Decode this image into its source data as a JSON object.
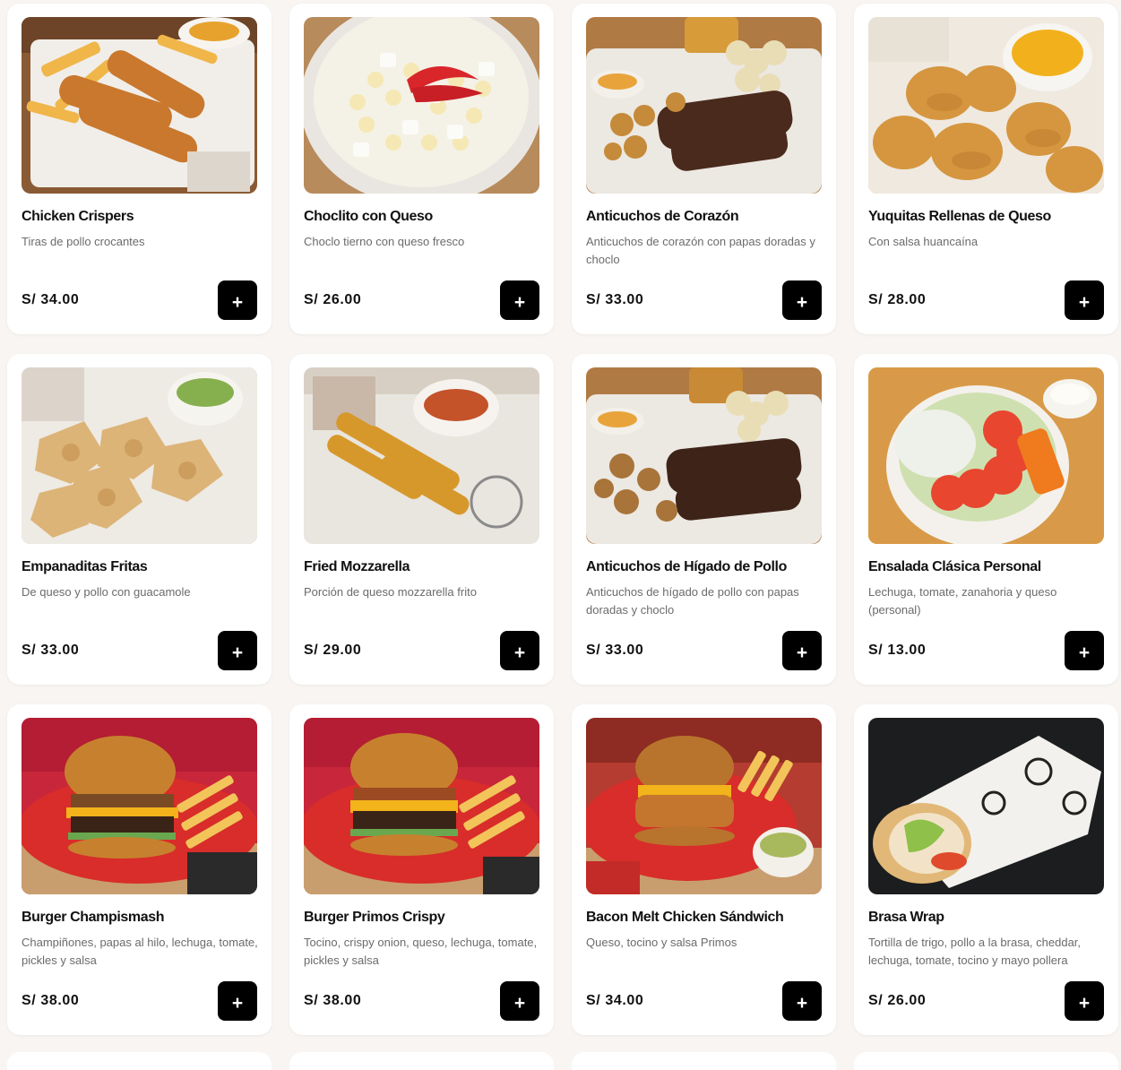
{
  "products": [
    {
      "name": "Chicken Crispers",
      "description": "Tiras de pollo crocantes",
      "price": "S/ 34.00",
      "add_label": "+"
    },
    {
      "name": "Choclito con Queso",
      "description": "Choclo tierno con queso fresco",
      "price": "S/ 26.00",
      "add_label": "+"
    },
    {
      "name": "Anticuchos de Corazón",
      "description": "Anticuchos de corazón con papas doradas y choclo",
      "price": "S/ 33.00",
      "add_label": "+"
    },
    {
      "name": "Yuquitas Rellenas de Queso",
      "description": "Con salsa huancaína",
      "price": "S/ 28.00",
      "add_label": "+"
    },
    {
      "name": "Empanaditas Fritas",
      "description": "De queso y pollo con guacamole",
      "price": "S/ 33.00",
      "add_label": "+"
    },
    {
      "name": "Fried Mozzarella",
      "description": "Porción de queso mozzarella frito",
      "price": "S/ 29.00",
      "add_label": "+"
    },
    {
      "name": "Anticuchos de Hígado de Pollo",
      "description": "Anticuchos de hígado de pollo con papas doradas y choclo",
      "price": "S/ 33.00",
      "add_label": "+"
    },
    {
      "name": "Ensalada Clásica Personal",
      "description": "Lechuga, tomate, zanahoria y queso (personal)",
      "price": "S/ 13.00",
      "add_label": "+"
    },
    {
      "name": "Burger Champismash",
      "description": "Champiñones, papas al hilo, lechuga, tomate, pickles y salsa",
      "price": "S/ 38.00",
      "add_label": "+"
    },
    {
      "name": "Burger Primos Crispy",
      "description": "Tocino, crispy onion, queso, lechuga, tomate, pickles y salsa",
      "price": "S/ 38.00",
      "add_label": "+"
    },
    {
      "name": "Bacon Melt Chicken Sándwich",
      "description": "Queso, tocino y salsa Primos",
      "price": "S/ 34.00",
      "add_label": "+"
    },
    {
      "name": "Brasa Wrap",
      "description": "Tortilla de trigo, pollo a la brasa, cheddar, lechuga, tomate, tocino y mayo pollera",
      "price": "S/ 26.00",
      "add_label": "+"
    }
  ]
}
